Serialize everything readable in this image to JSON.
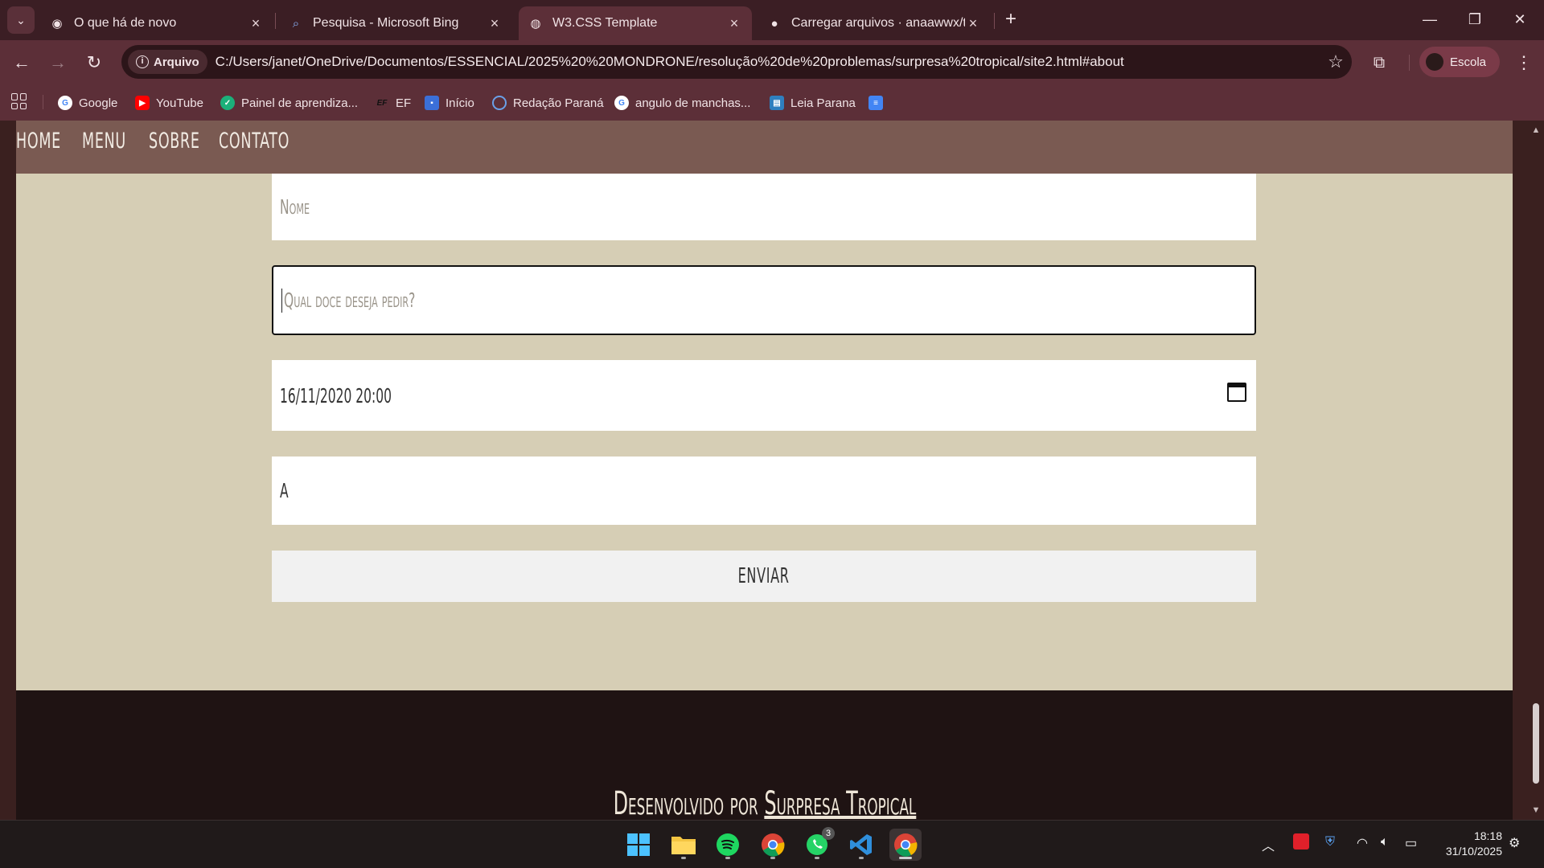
{
  "browser": {
    "tabs": [
      {
        "title": "O que há de novo",
        "icon": "chrome-icon",
        "active": false
      },
      {
        "title": "Pesquisa - Microsoft Bing",
        "icon": "search-icon",
        "active": false
      },
      {
        "title": "W3.CSS Template",
        "icon": "globe-icon",
        "active": true
      },
      {
        "title": "Carregar arquivos · anaawwx/tr",
        "icon": "github-icon",
        "active": false
      }
    ],
    "address": {
      "security_chip": "Arquivo",
      "url": "C:/Users/janet/OneDrive/Documentos/ESSENCIAL/2025%20%20MONDRONE/resolução%20de%20problemas/surpresa%20tropical/site2.html#about"
    },
    "profile": "Escola",
    "bookmarks": [
      "Google",
      "YouTube",
      "Painel de aprendiza...",
      "EF",
      "Início",
      "Redação Paraná",
      "angulo de manchas...",
      "Leia Parana"
    ]
  },
  "page": {
    "nav": [
      "HOME",
      "MENU",
      "SOBRE",
      "CONTATO"
    ],
    "form": {
      "name_placeholder": "Nome",
      "order_placeholder": "Qual doce deseja pedir?",
      "datetime_value": "16/11/2020 20:00",
      "message_value": "A",
      "submit_label": "ENVIAR"
    },
    "footer": {
      "prefix": "Desenvolvido por",
      "link": "Surpresa Tropical"
    }
  },
  "taskbar": {
    "apps": [
      "windows-start-icon",
      "file-explorer-icon",
      "spotify-icon",
      "chrome-icon",
      "whatsapp-icon",
      "vscode-icon",
      "chrome-icon"
    ],
    "whatsapp_badge": "3",
    "time": "18:18",
    "date": "31/10/2025"
  },
  "colors": {
    "chrome_bg": "#5c2f38",
    "titlebar_bg": "#3b1e24",
    "page_bg": "#d6ceb5",
    "navbar_bg": "#7a5a52",
    "footer_bg": "#1f1313"
  }
}
